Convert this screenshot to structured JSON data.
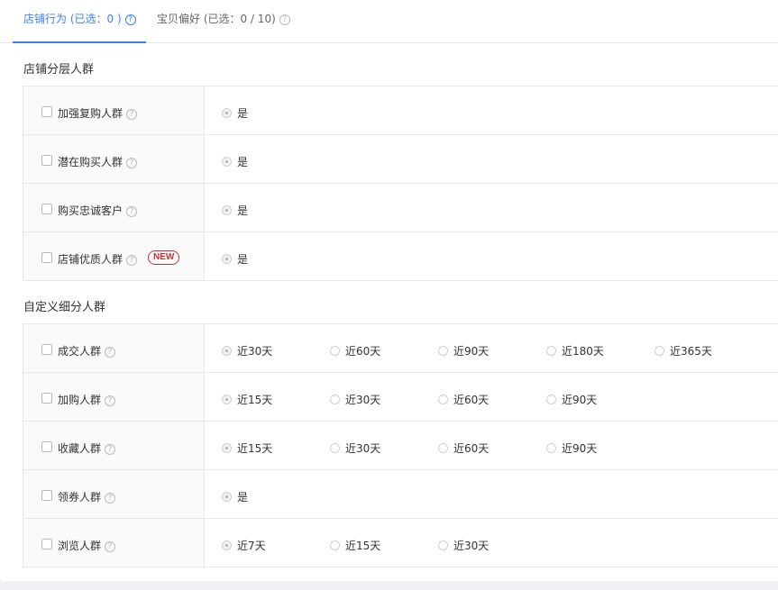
{
  "tabs": [
    {
      "label": "店铺行为 (已选：0 )",
      "active": true
    },
    {
      "label": "宝贝偏好 (已选：0 / 10)",
      "active": false
    }
  ],
  "sections": {
    "layered": {
      "title": "店铺分层人群",
      "rows": [
        {
          "label": "加强复购人群",
          "options": [
            "是"
          ]
        },
        {
          "label": "潜在购买人群",
          "options": [
            "是"
          ]
        },
        {
          "label": "购买忠诚客户",
          "options": [
            "是"
          ]
        },
        {
          "label": "店铺优质人群",
          "badge": "NEW",
          "options": [
            "是"
          ]
        }
      ]
    },
    "custom": {
      "title": "自定义细分人群",
      "rows": [
        {
          "label": "成交人群",
          "options": [
            "近30天",
            "近60天",
            "近90天",
            "近180天",
            "近365天"
          ]
        },
        {
          "label": "加购人群",
          "options": [
            "近15天",
            "近30天",
            "近60天",
            "近90天"
          ]
        },
        {
          "label": "收藏人群",
          "options": [
            "近15天",
            "近30天",
            "近60天",
            "近90天"
          ]
        },
        {
          "label": "领券人群",
          "options": [
            "是"
          ]
        },
        {
          "label": "浏览人群",
          "options": [
            "近7天",
            "近15天",
            "近30天"
          ]
        }
      ]
    }
  },
  "help_glyph": "?",
  "colors": {
    "accent": "#3a7ff6",
    "badge": "#c8333b"
  }
}
